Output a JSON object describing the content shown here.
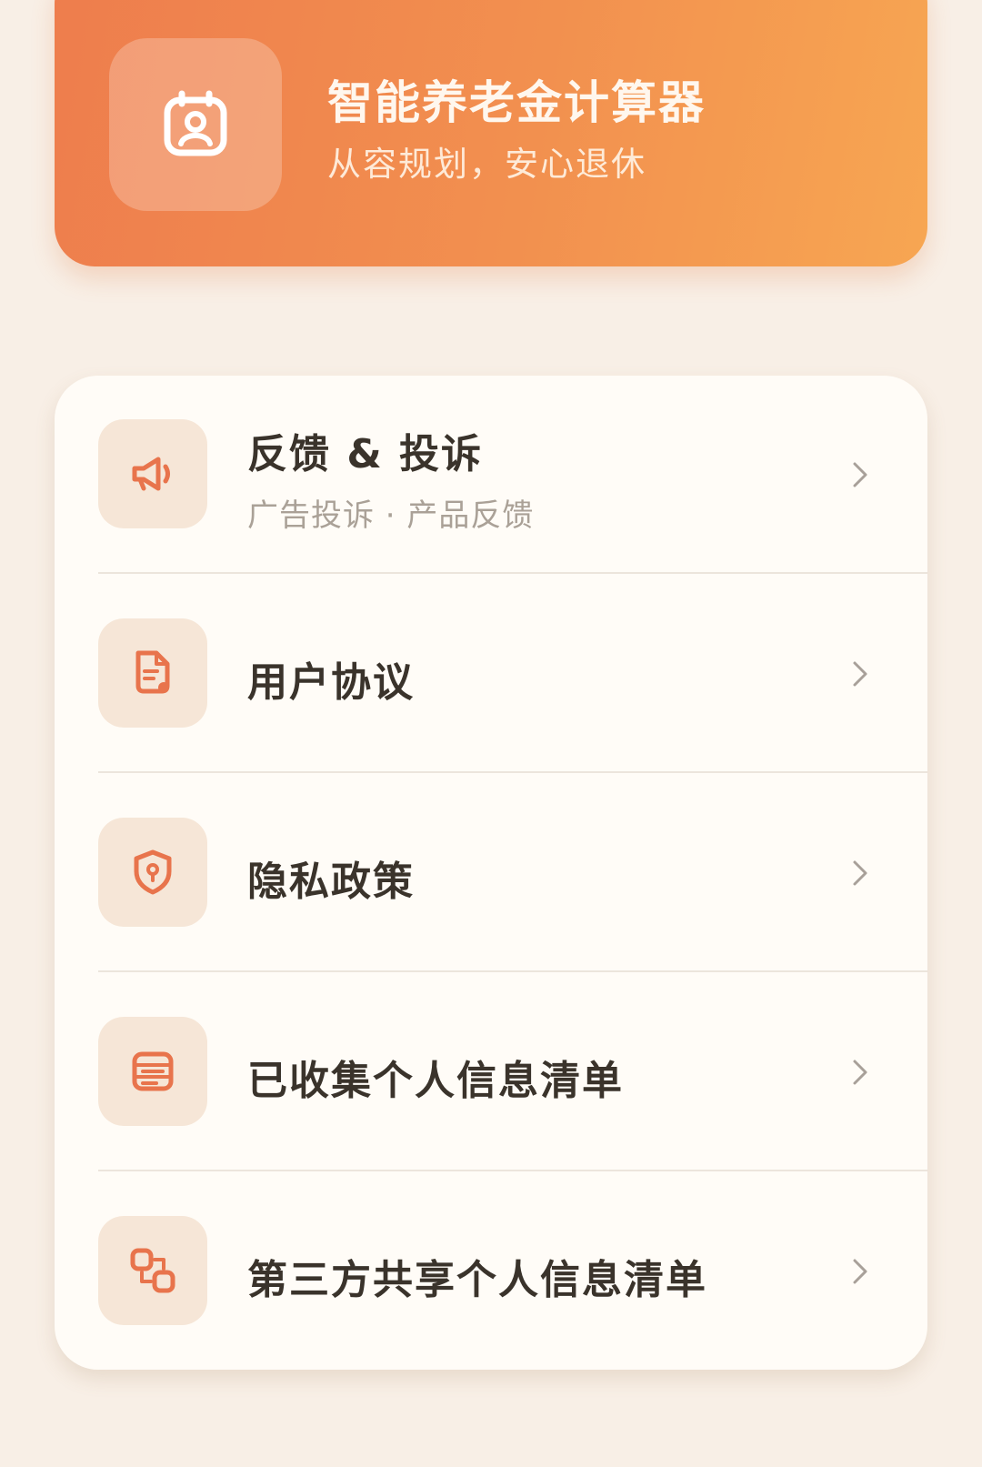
{
  "colors": {
    "banner_start": "#ee7d4d",
    "banner_end": "#f7a652",
    "accent": "#e8744c",
    "page_bg": "#f8efe6",
    "card_bg": "#fffcf7",
    "icon_tile_bg": "#f6e6d7",
    "title_text": "#3a332b",
    "subtitle_text": "#aaa197"
  },
  "header": {
    "icon": "user-id-card-icon",
    "title": "智能养老金计算器",
    "subtitle": "从容规划，安心退休"
  },
  "menu": {
    "items": [
      {
        "title": "反馈 & 投诉",
        "subtitle": "广告投诉 · 产品反馈",
        "icon": "megaphone-icon"
      },
      {
        "title": "用户协议",
        "icon": "document-icon"
      },
      {
        "title": "隐私政策",
        "icon": "shield-icon"
      },
      {
        "title": "已收集个人信息清单",
        "icon": "list-icon"
      },
      {
        "title": "第三方共享个人信息清单",
        "icon": "share-icon"
      }
    ]
  }
}
